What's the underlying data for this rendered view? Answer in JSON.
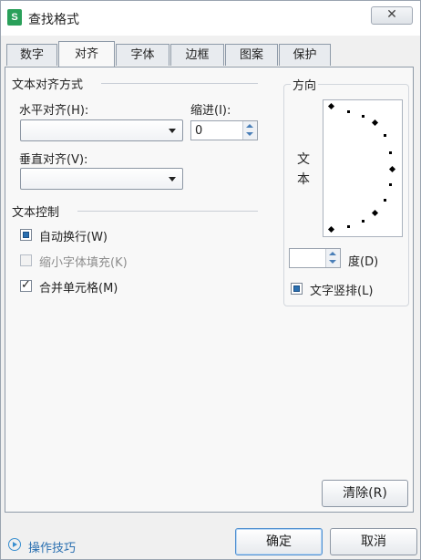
{
  "window": {
    "title": "查找格式",
    "app_icon": "S",
    "close": "✕"
  },
  "tabs": [
    "数字",
    "对齐",
    "字体",
    "边框",
    "图案",
    "保护"
  ],
  "alignment": {
    "section_title": "文本对齐方式",
    "horizontal_label": "水平对齐(H):",
    "horizontal_value": "",
    "indent_label": "缩进(I):",
    "indent_value": "0",
    "vertical_label": "垂直对齐(V):",
    "vertical_value": ""
  },
  "text_control": {
    "section_title": "文本控制",
    "wrap_text": {
      "label": "自动换行(W)",
      "state": "indeterminate"
    },
    "shrink_to_fit": {
      "label": "缩小字体填充(K)",
      "state": "disabled"
    },
    "merge_cells": {
      "label": "合并单元格(M)",
      "state": "checked"
    }
  },
  "orientation": {
    "section_title": "方向",
    "sample_text": [
      "文",
      "本"
    ],
    "degree_value": "",
    "degree_label": "度(D)",
    "vertical_text_label": "文字竖排(L)",
    "vertical_text_state": "indeterminate"
  },
  "buttons": {
    "clear": "清除(R)",
    "ok": "确定",
    "cancel": "取消"
  },
  "footer": {
    "tips_link": "操作技巧"
  },
  "colors": {
    "accent": "#2a6fb0",
    "tab_border": "#8e9aa8"
  }
}
